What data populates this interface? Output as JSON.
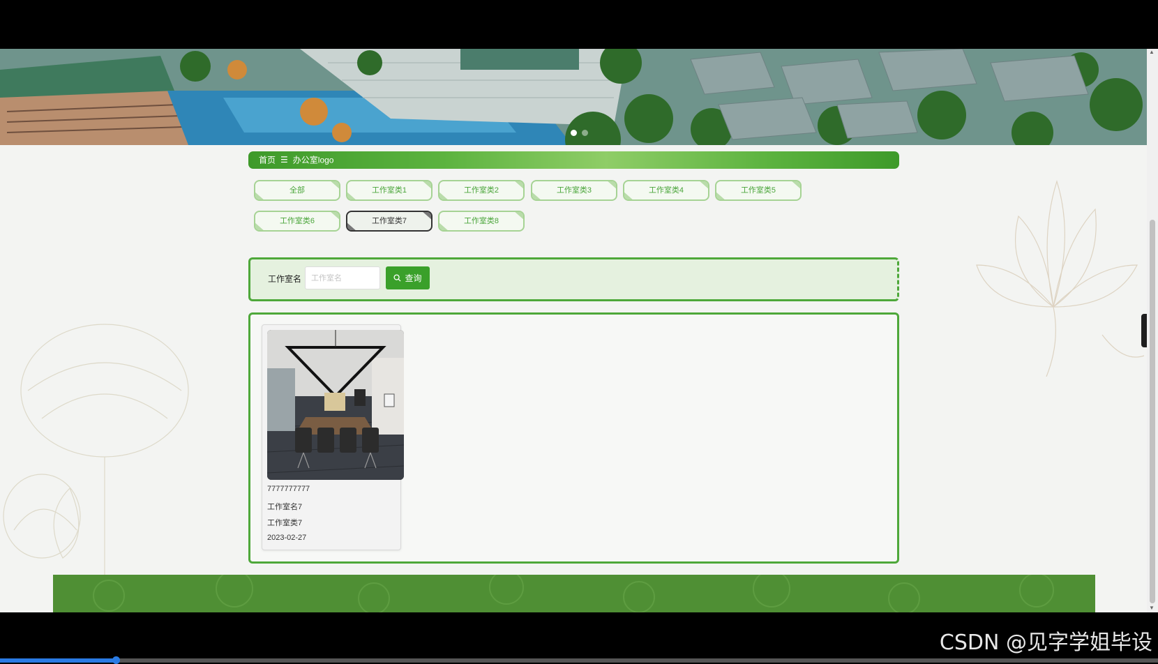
{
  "breadcrumb": {
    "home": "首页",
    "separator": "☰",
    "current": "办公室logo"
  },
  "categories": [
    {
      "label": "全部",
      "active": false
    },
    {
      "label": "工作室类1",
      "active": false
    },
    {
      "label": "工作室类2",
      "active": false
    },
    {
      "label": "工作室类3",
      "active": false
    },
    {
      "label": "工作室类4",
      "active": false
    },
    {
      "label": "工作室类5",
      "active": false
    },
    {
      "label": "工作室类6",
      "active": false
    },
    {
      "label": "工作室类7",
      "active": true
    },
    {
      "label": "工作室类8",
      "active": false
    }
  ],
  "search": {
    "label": "工作室名",
    "placeholder": "工作室名",
    "value": "",
    "button_label": "查询",
    "button_icon": "search-icon"
  },
  "results": [
    {
      "image_icon": "meeting-room-photo",
      "code": "7777777777",
      "name": "工作室名7",
      "category": "工作室类7",
      "date": "2023-02-27"
    }
  ],
  "side_toggle": {
    "icon": "chevron-right-icon",
    "glyph": "›"
  },
  "watermark": "CSDN @见字学姐毕设",
  "video_progress": 0.1,
  "colors": {
    "accent_green": "#3aa02a",
    "footer_green": "#4f8f34",
    "tag_border": "#a6d394"
  }
}
